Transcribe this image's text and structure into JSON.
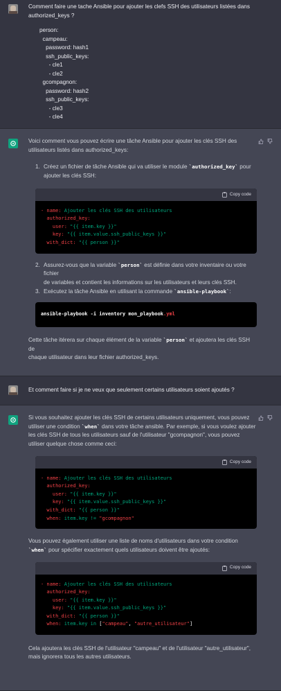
{
  "turns": {
    "q1": {
      "line1": "Comment faire une tache Ansible pour ajouter les clefs SSH des utilisateurs listées dans",
      "line2": "authorized_keys ?",
      "yaml": "person:\n  campeau:\n    password: hash1\n    ssh_public_keys:\n      - cle1\n      - cle2\n  gcompagnon:\n    password: hash2\n    ssh_public_keys:\n      - cle3\n      - cle4"
    },
    "a1": {
      "intro_l1": "Voici comment vous pouvez écrire une tâche Ansible pour ajouter les clés SSH des",
      "intro_l2": "utilisateurs listés dans authorized_keys:",
      "step1_num": "1.",
      "step1_a": "Créez un fichier de tâche Ansible qui va utiliser le module ",
      "step1_code": "`authorized_key`",
      "step1_b": " pour",
      "step1_c": "ajouter les clés SSH:",
      "copy_label": "Copy code",
      "code1": {
        "l1a": "- name: ",
        "l1b": "Ajouter les clés SSH des utilisateurs",
        "l2": "  authorized_key:",
        "l3a": "    user: ",
        "l3b": "\"{{ item.key }}\"",
        "l4a": "    key: ",
        "l4b": "\"{{ item.value.ssh_public_keys }}\"",
        "l5a": "  with_dict: ",
        "l5b": "\"{{ person }}\""
      },
      "step2_num": "2.",
      "step2_a": "Assurez-vous que la variable ",
      "step2_code": "`person`",
      "step2_b": " est définie dans votre inventaire ou votre fichier",
      "step2_c": "de variables et contient les informations sur les utilisateurs et leurs clés SSH.",
      "step3_num": "3.",
      "step3_a": "Exécutez la tâche Ansible en utilisant la commande ",
      "step3_code": "`ansible-playbook`",
      "step3_b": ":",
      "code2": {
        "a": "ansible-playbook -i inventory mon_playbook",
        "b": ".yml"
      },
      "outro_l1a": "Cette tâche itérera sur chaque élément de la variable ",
      "outro_code": "`person`",
      "outro_l1b": " et ajoutera les clés SSH de",
      "outro_l2": "chaque utilisateur dans leur fichier authorized_keys."
    },
    "q2": {
      "text": "Et comment faire si je ne veux que seulement certains utilisateurs soient ajoutés ?"
    },
    "a2": {
      "p1_l1": "Si vous souhaitez ajouter les clés SSH de certains utilisateurs uniquement, vous pouvez",
      "p1_l2a": "utiliser une condition ",
      "p1_code": "`when`",
      "p1_l2b": " dans votre tâche ansible. Par exemple, si vous voulez ajouter",
      "p1_l3": "les clés SSH de tous les utilisateurs sauf de l'utilisateur \"gcompagnon\", vous pouvez",
      "p1_l4": "utiliser quelque chose comme ceci:",
      "code3": {
        "l1a": "- name: ",
        "l1b": "Ajouter les clés SSH des utilisateurs",
        "l2": "  authorized_key:",
        "l3a": "    user: ",
        "l3b": "\"{{ item.key }}\"",
        "l4a": "    key: ",
        "l4b": "\"{{ item.value.ssh_public_keys }}\"",
        "l5a": "  with_dict: ",
        "l5b": "\"{{ person }}\"",
        "l6a": "  when: ",
        "l6b": "item.key != ",
        "l6c": "\"gcompagnon\""
      },
      "p2_l1": "Vous pouvez également utiliser une liste de noms d'utilisateurs dans votre condition",
      "p2_code": "`when`",
      "p2_l2b": " pour spécifier exactement quels utilisateurs doivent être ajoutés:",
      "code4": {
        "l1a": "- name: ",
        "l1b": "Ajouter les clés SSH des utilisateurs",
        "l2": "  authorized_key:",
        "l3a": "    user: ",
        "l3b": "\"{{ item.key }}\"",
        "l4a": "    key: ",
        "l4b": "\"{{ item.value.ssh_public_keys }}\"",
        "l5a": "  with_dict: ",
        "l5b": "\"{{ person }}\"",
        "l6a": "  when: ",
        "l6b": "item.key in ",
        "l6c": "[",
        "l6d": "\"campeau\"",
        "l6e": ", ",
        "l6f": "\"autre_utilisateur\"",
        "l6g": "]"
      },
      "p3_l1": "Cela ajoutera les clés SSH de l'utilisateur \"campeau\" et de l'utilisateur \"autre_utilisateur\",",
      "p3_l2": "mais ignorera tous les autres utilisateurs."
    }
  },
  "colors": {
    "user_bg": "#343541",
    "bot_bg": "#444654",
    "accent": "#10a37f",
    "code_red": "#ef4146",
    "code_green": "#00a67d",
    "code_pink": "#df3079"
  },
  "icons": [
    "user-avatar-icon",
    "openai-logo-icon",
    "thumbs-up-icon",
    "thumbs-down-icon",
    "clipboard-icon"
  ]
}
